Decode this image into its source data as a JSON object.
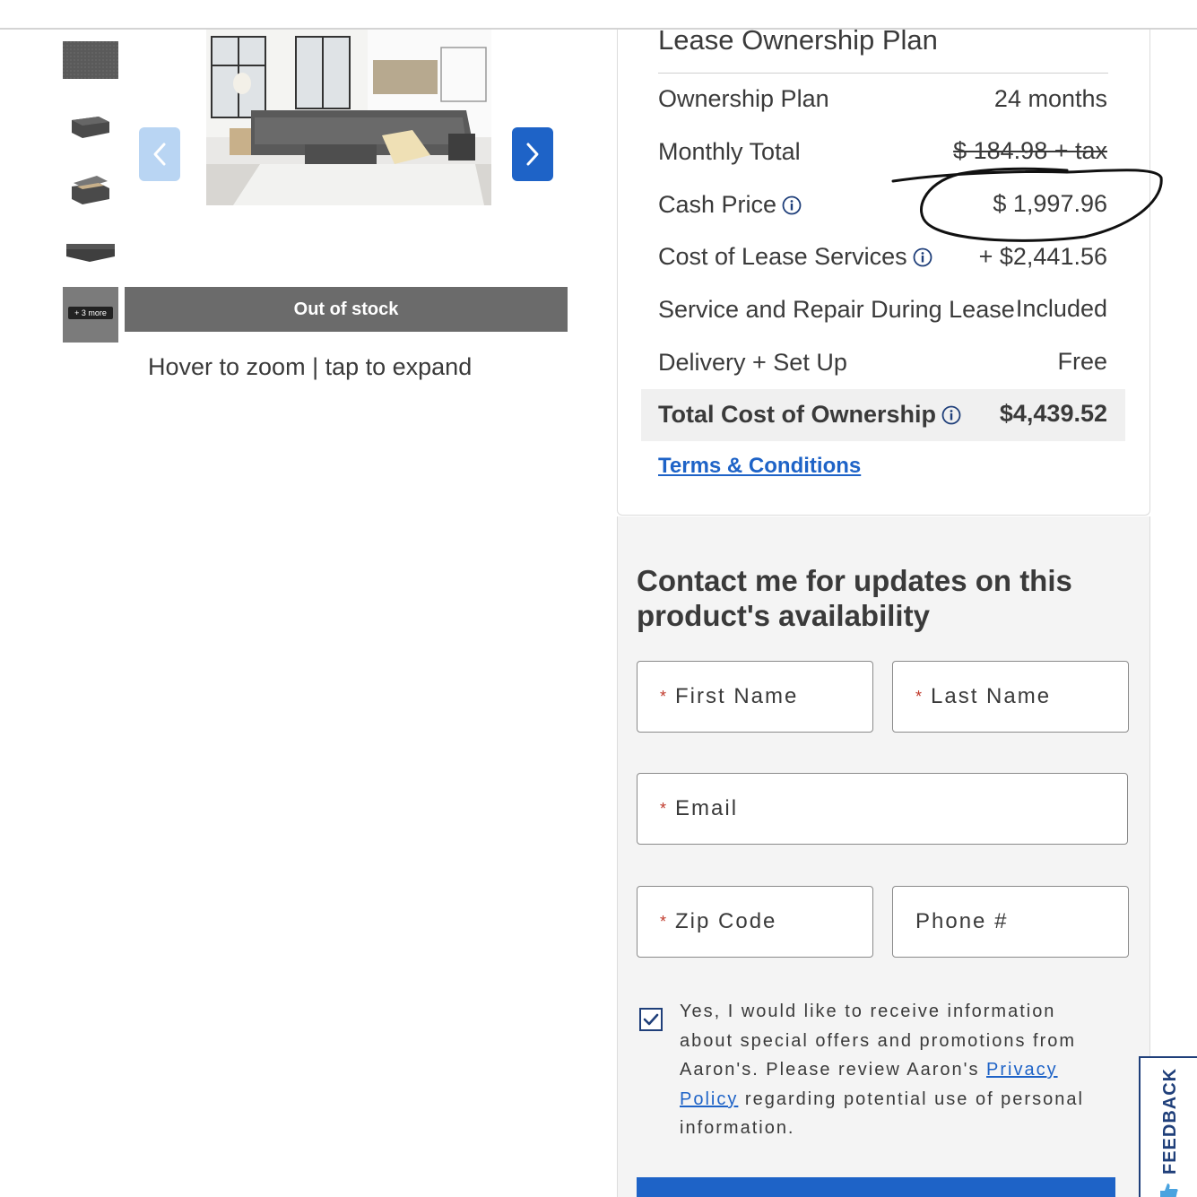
{
  "gallery": {
    "thumbnails": [
      "fabric-swatch",
      "ottoman",
      "storage-ottoman-open",
      "sectional-side",
      "sectional-room"
    ],
    "more_label": "+ 3 more",
    "out_of_stock_label": "Out of stock",
    "zoom_hint": "Hover to zoom | tap to expand"
  },
  "lease": {
    "title": "Lease Ownership Plan",
    "rows": [
      {
        "label": "Ownership Plan",
        "value": "24 months",
        "info": false
      },
      {
        "label": "Monthly Total",
        "value": "$ 184.98 + tax",
        "info": false,
        "struck": true
      },
      {
        "label": "Cash Price",
        "value": "$ 1,997.96",
        "info": true
      },
      {
        "label": "Cost of Lease Services",
        "value": "+ $2,441.56",
        "info": true
      },
      {
        "label": "Service and Repair During Lease",
        "value": "Included",
        "info": false
      },
      {
        "label": "Delivery + Set Up",
        "value": "Free",
        "info": false
      }
    ],
    "total_label": "Total Cost of Ownership",
    "total_value": "$4,439.52",
    "terms_link": "Terms & Conditions"
  },
  "contact": {
    "title": "Contact me for updates on this product's availability",
    "required_mark": "*",
    "fields": {
      "first_name": "First Name",
      "last_name": "Last Name",
      "email": "Email",
      "zip": "Zip Code",
      "phone": "Phone #"
    },
    "consent_checked": true,
    "consent_text_before": "Yes, I would like to receive information about special offers and promotions from Aaron's. Please review Aaron's ",
    "consent_link": "Privacy Policy",
    "consent_text_after": " regarding potential use of personal information."
  },
  "feedback_label": "FEEDBACK",
  "colors": {
    "accent_blue": "#1e63c7",
    "navy": "#1f3f7a",
    "out_of_stock_bg": "#6b6b6b",
    "panel_bg": "#f4f4f4",
    "required_red": "#c0392b"
  },
  "icons": [
    "chevron-left-icon",
    "chevron-right-icon",
    "info-icon",
    "checkmark-icon",
    "thumbs-up-icon"
  ]
}
